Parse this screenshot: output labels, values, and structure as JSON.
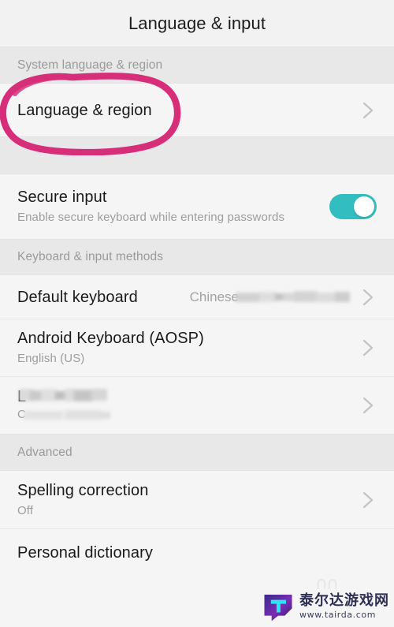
{
  "app": {
    "title": "Language & input"
  },
  "sections": [
    {
      "header": "System language & region",
      "rows": [
        {
          "title": "Language & region",
          "sub": "",
          "value": "",
          "accessory": "chevron"
        }
      ]
    },
    {
      "header": "",
      "rows": [
        {
          "title": "Secure input",
          "sub": "Enable secure keyboard while entering passwords",
          "value": "",
          "accessory": "toggle",
          "toggle_on": true
        }
      ]
    },
    {
      "header": "Keyboard & input methods",
      "rows": [
        {
          "title": "Default keyboard",
          "sub": "",
          "value": "Chinese",
          "value_redacted": true,
          "accessory": "chevron"
        },
        {
          "title": "Android Keyboard (AOSP)",
          "sub": "English (US)",
          "value": "",
          "accessory": "chevron"
        },
        {
          "title": "L",
          "title_redacted": true,
          "sub": "C",
          "sub_redacted": true,
          "value": "",
          "accessory": "chevron"
        }
      ]
    },
    {
      "header": "Advanced",
      "rows": [
        {
          "title": "Spelling correction",
          "sub": "Off",
          "value": "",
          "accessory": "chevron"
        },
        {
          "title": "Personal dictionary",
          "sub": "",
          "value": "",
          "accessory": "chevron"
        }
      ]
    }
  ],
  "annotation": {
    "shape": "hand-drawn-ellipse",
    "color": "#d62e78",
    "targets": "Language & region"
  },
  "watermark": {
    "name_cn": "泰尔达游戏网",
    "url": "www.tairda.com",
    "logo_letter": "T"
  },
  "colors": {
    "toggle_on": "#32bec0",
    "annotation_pink": "#d62e78",
    "row_bg": "#f5f5f5",
    "band_bg": "#e8e8e8",
    "title_text": "#1a1a1a",
    "sub_text": "#9d9d9d"
  }
}
